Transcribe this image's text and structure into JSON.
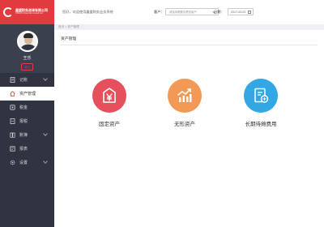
{
  "brand": {
    "name": "鑫盟财务咨询有限公司",
    "sub": "XINHUI Financial Consult Ltd"
  },
  "user": {
    "name": "王乐",
    "logout_label": "退出"
  },
  "nav": [
    {
      "label": "记账",
      "icon": "ledger-icon",
      "chevron": true
    },
    {
      "label": "资产管理",
      "icon": "home-icon",
      "active": true
    },
    {
      "label": "税金",
      "icon": "tax-icon"
    },
    {
      "label": "报税",
      "icon": "declare-icon"
    },
    {
      "label": "账簿",
      "icon": "book-icon",
      "chevron": true
    },
    {
      "label": "报表",
      "icon": "report-icon"
    },
    {
      "label": "设置",
      "icon": "gear-icon",
      "chevron": true
    }
  ],
  "topbar": {
    "welcome": "您好，欢迎使用鑫盟财务业务系统",
    "client_label": "客户：",
    "client_placeholder": "请选择需要查看的客户",
    "date_label": "日期：",
    "date_value": "2017-03-03"
  },
  "breadcrumb": "首页 > 资产管理",
  "panel": {
    "title": "资产管理"
  },
  "tiles": [
    {
      "label": "固定资产",
      "icon": "yuan-tag-icon",
      "color": "#e6505d"
    },
    {
      "label": "无形资产",
      "icon": "growth-chart-icon",
      "color": "#f29a55"
    },
    {
      "label": "长期待摊费用",
      "icon": "document-coin-icon",
      "color": "#33a6e4"
    }
  ],
  "colors": {
    "accent": "#e23b3f",
    "sidebar": "#2f3440"
  }
}
